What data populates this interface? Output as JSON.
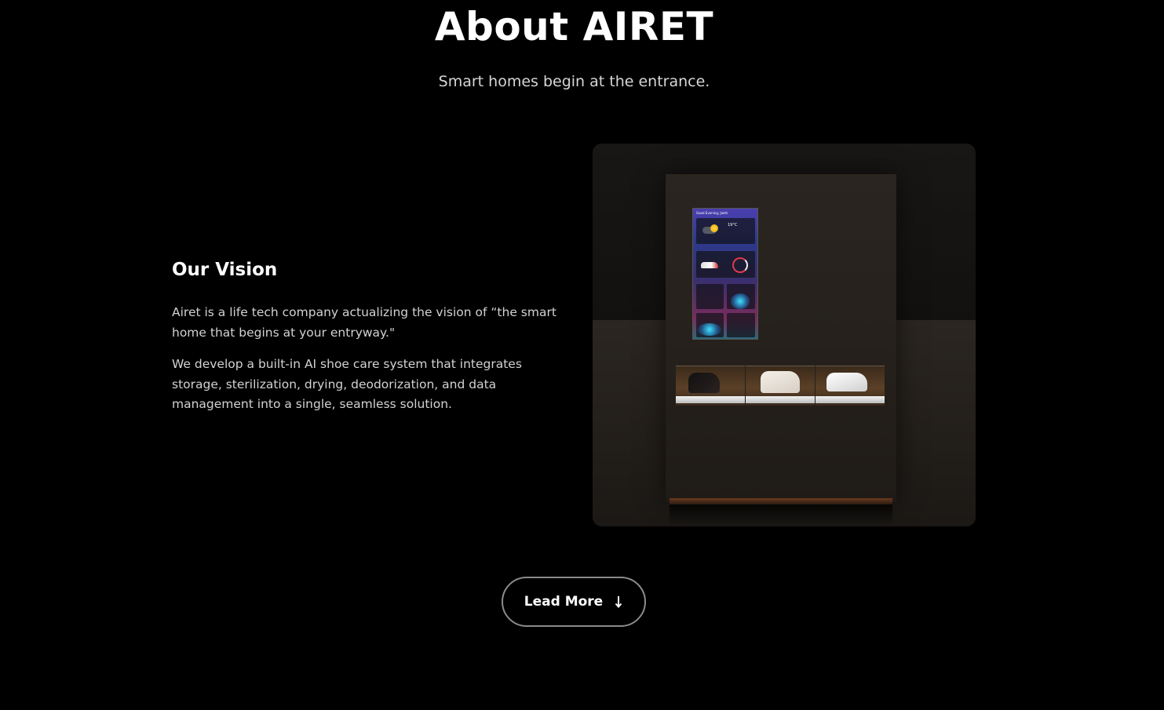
{
  "header": {
    "title": "About AIRET",
    "subtitle": "Smart homes begin at the entrance."
  },
  "vision": {
    "heading": "Our Vision",
    "paragraphs": [
      "Airet is a life tech company actualizing the vision of “the smart home that begins at your entryway.\"",
      "We develop a built-in AI shoe care system that integrates storage, sterilization, drying, deodorization, and data management into a single, seamless solution."
    ]
  },
  "image": {
    "description_icon": "smart-shoe-cabinet-image",
    "screen": {
      "greeting": "Good Evening, Jaehi",
      "temperature": "19°C"
    }
  },
  "cta": {
    "label": "Lead More",
    "icon": "arrow-down-icon"
  },
  "colors": {
    "background": "#000000",
    "text": "#ffffff",
    "muted_text": "#d2d2d2",
    "button_border": "#8a8a8a"
  }
}
